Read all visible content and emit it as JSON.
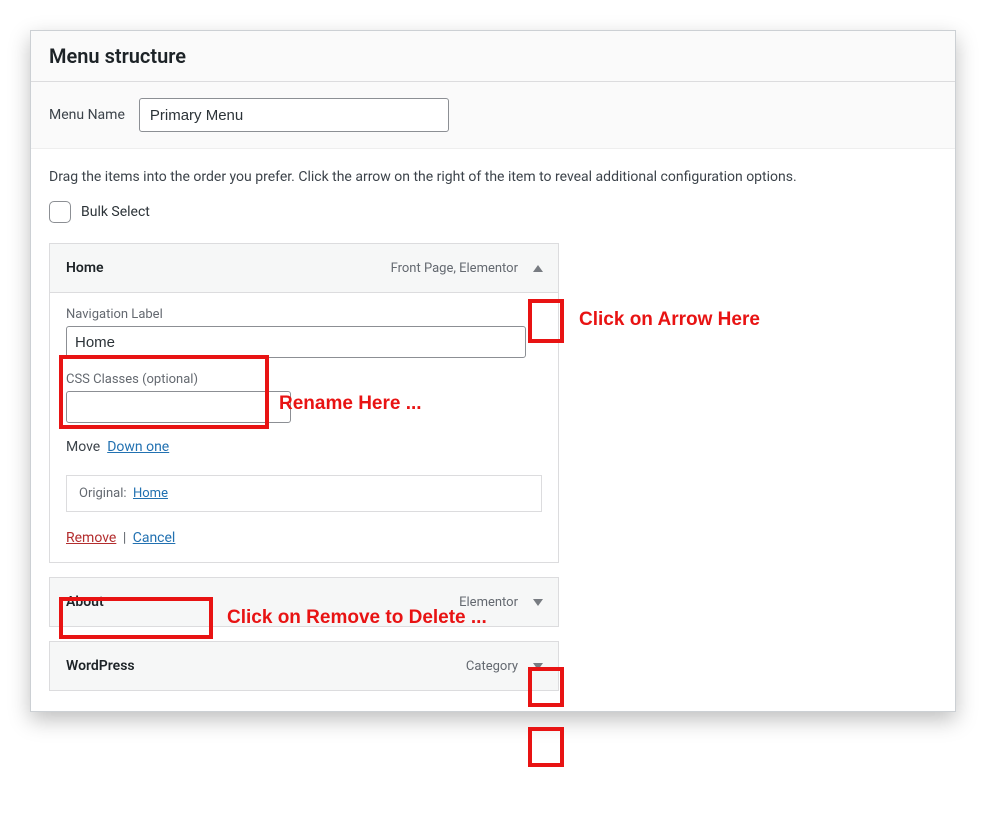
{
  "header": {
    "title": "Menu structure"
  },
  "menuName": {
    "label": "Menu Name",
    "value": "Primary Menu"
  },
  "instructions": "Drag the items into the order you prefer. Click the arrow on the right of the item to reveal additional configuration options.",
  "bulkSelect": {
    "label": "Bulk Select"
  },
  "items": [
    {
      "title": "Home",
      "type": "Front Page, Elementor",
      "expanded": true,
      "settings": {
        "navLabel": {
          "label": "Navigation Label",
          "value": "Home"
        },
        "cssClasses": {
          "label": "CSS Classes (optional)",
          "value": ""
        },
        "move": {
          "label": "Move",
          "downOne": "Down one"
        },
        "original": {
          "label": "Original:",
          "link": "Home"
        },
        "remove": "Remove",
        "cancel": "Cancel"
      }
    },
    {
      "title": "About",
      "type": "Elementor",
      "expanded": false
    },
    {
      "title": "WordPress",
      "type": "Category",
      "expanded": false
    }
  ],
  "annotations": {
    "arrow": "Click on Arrow Here",
    "rename": "Rename Here ...",
    "removeDelete": "Click on Remove to Delete ..."
  }
}
